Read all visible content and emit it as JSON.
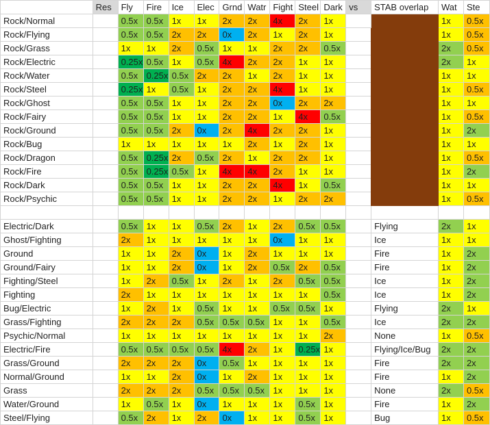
{
  "sheet": {
    "header": {
      "name": "",
      "res": "Res",
      "types": [
        "Fly",
        "Fire",
        "Ice",
        "Elec",
        "Grnd",
        "Watr",
        "Fight",
        "Steel",
        "Dark"
      ],
      "vs": "vs",
      "stab": "STAB overlap",
      "wat": "Wat",
      "ste": "Ste"
    },
    "colors": {
      "0x": "#00B0F0",
      "0.25x": "#00B050",
      "0.5x": "#92D050",
      "1x": "#FFFF00",
      "2x": "#FFC000",
      "4x": "#FF0000",
      "header_gray": "#D9D9D9",
      "stab_block": "#843C0C",
      "offense": {
        "0.5x": "#FFC000",
        "1x": "#FFFF00",
        "2x": "#92D050"
      }
    },
    "upper_rows": [
      {
        "name": "Rock/Normal",
        "vals": [
          "0.5x",
          "0.5x",
          "1x",
          "1x",
          "2x",
          "2x",
          "4x",
          "2x",
          "1x"
        ],
        "wat": "1x",
        "ste": "0.5x"
      },
      {
        "name": "Rock/Flying",
        "vals": [
          "0.5x",
          "0.5x",
          "2x",
          "2x",
          "0x",
          "2x",
          "1x",
          "2x",
          "1x"
        ],
        "wat": "1x",
        "ste": "0.5x"
      },
      {
        "name": "Rock/Grass",
        "vals": [
          "1x",
          "1x",
          "2x",
          "0.5x",
          "1x",
          "1x",
          "2x",
          "2x",
          "0.5x"
        ],
        "wat": "2x",
        "ste": "0.5x"
      },
      {
        "name": "Rock/Electric",
        "vals": [
          "0.25x",
          "0.5x",
          "1x",
          "0.5x",
          "4x",
          "2x",
          "2x",
          "1x",
          "1x"
        ],
        "wat": "2x",
        "ste": "1x"
      },
      {
        "name": "Rock/Water",
        "vals": [
          "0.5x",
          "0.25x",
          "0.5x",
          "2x",
          "2x",
          "1x",
          "2x",
          "1x",
          "1x"
        ],
        "wat": "1x",
        "ste": "1x"
      },
      {
        "name": "Rock/Steel",
        "vals": [
          "0.25x",
          "1x",
          "0.5x",
          "1x",
          "2x",
          "2x",
          "4x",
          "1x",
          "1x"
        ],
        "wat": "1x",
        "ste": "0.5x"
      },
      {
        "name": "Rock/Ghost",
        "vals": [
          "0.5x",
          "0.5x",
          "1x",
          "1x",
          "2x",
          "2x",
          "0x",
          "2x",
          "2x"
        ],
        "wat": "1x",
        "ste": "1x"
      },
      {
        "name": "Rock/Fairy",
        "vals": [
          "0.5x",
          "0.5x",
          "1x",
          "1x",
          "2x",
          "2x",
          "1x",
          "4x",
          "0.5x"
        ],
        "wat": "1x",
        "ste": "0.5x"
      },
      {
        "name": "Rock/Ground",
        "vals": [
          "0.5x",
          "0.5x",
          "2x",
          "0x",
          "2x",
          "4x",
          "2x",
          "2x",
          "1x"
        ],
        "wat": "1x",
        "ste": "2x"
      },
      {
        "name": "Rock/Bug",
        "vals": [
          "1x",
          "1x",
          "1x",
          "1x",
          "1x",
          "2x",
          "1x",
          "2x",
          "1x"
        ],
        "wat": "1x",
        "ste": "1x"
      },
      {
        "name": "Rock/Dragon",
        "vals": [
          "0.5x",
          "0.25x",
          "2x",
          "0.5x",
          "2x",
          "1x",
          "2x",
          "2x",
          "1x"
        ],
        "wat": "1x",
        "ste": "0.5x"
      },
      {
        "name": "Rock/Fire",
        "vals": [
          "0.5x",
          "0.25x",
          "0.5x",
          "1x",
          "4x",
          "4x",
          "2x",
          "1x",
          "1x"
        ],
        "wat": "1x",
        "ste": "2x"
      },
      {
        "name": "Rock/Dark",
        "vals": [
          "0.5x",
          "0.5x",
          "1x",
          "1x",
          "2x",
          "2x",
          "4x",
          "1x",
          "0.5x"
        ],
        "wat": "1x",
        "ste": "1x"
      },
      {
        "name": "Rock/Psychic",
        "vals": [
          "0.5x",
          "0.5x",
          "1x",
          "1x",
          "2x",
          "2x",
          "1x",
          "2x",
          "2x"
        ],
        "wat": "1x",
        "ste": "0.5x"
      }
    ],
    "lower_rows": [
      {
        "name": "Electric/Dark",
        "vals": [
          "0.5x",
          "1x",
          "1x",
          "0.5x",
          "2x",
          "1x",
          "2x",
          "0.5x",
          "0.5x"
        ],
        "stab": "Flying",
        "wat": "2x",
        "ste": "1x"
      },
      {
        "name": "Ghost/Fighting",
        "vals": [
          "2x",
          "1x",
          "1x",
          "1x",
          "1x",
          "1x",
          "0x",
          "1x",
          "1x"
        ],
        "stab": "Ice",
        "wat": "1x",
        "ste": "1x"
      },
      {
        "name": "Ground",
        "vals": [
          "1x",
          "1x",
          "2x",
          "0x",
          "1x",
          "2x",
          "1x",
          "1x",
          "1x"
        ],
        "stab": "Fire",
        "wat": "1x",
        "ste": "2x"
      },
      {
        "name": "Ground/Fairy",
        "vals": [
          "1x",
          "1x",
          "2x",
          "0x",
          "1x",
          "2x",
          "0.5x",
          "2x",
          "0.5x"
        ],
        "stab": "Fire",
        "wat": "1x",
        "ste": "2x"
      },
      {
        "name": "Fighting/Steel",
        "vals": [
          "1x",
          "2x",
          "0.5x",
          "1x",
          "2x",
          "1x",
          "2x",
          "0.5x",
          "0.5x"
        ],
        "stab": "Ice",
        "wat": "1x",
        "ste": "2x"
      },
      {
        "name": "Fighting",
        "vals": [
          "2x",
          "1x",
          "1x",
          "1x",
          "1x",
          "1x",
          "1x",
          "1x",
          "0.5x"
        ],
        "stab": "Ice",
        "wat": "1x",
        "ste": "2x"
      },
      {
        "name": "Bug/Electric",
        "vals": [
          "1x",
          "2x",
          "1x",
          "0.5x",
          "1x",
          "1x",
          "0.5x",
          "0.5x",
          "1x"
        ],
        "stab": "Flying",
        "wat": "2x",
        "ste": "1x"
      },
      {
        "name": "Grass/Fighting",
        "vals": [
          "2x",
          "2x",
          "2x",
          "0.5x",
          "0.5x",
          "0.5x",
          "1x",
          "1x",
          "0.5x"
        ],
        "stab": "Ice",
        "wat": "2x",
        "ste": "2x"
      },
      {
        "name": "Psychic/Normal",
        "vals": [
          "1x",
          "1x",
          "1x",
          "1x",
          "1x",
          "1x",
          "1x",
          "1x",
          "2x"
        ],
        "stab": "None",
        "wat": "1x",
        "ste": "0.5x"
      },
      {
        "name": "Electric/Fire",
        "vals": [
          "0.5x",
          "0.5x",
          "0.5x",
          "0.5x",
          "4x",
          "2x",
          "1x",
          "0.25x",
          "1x"
        ],
        "stab": "Flying/Ice/Bug",
        "wat": "2x",
        "ste": "2x"
      },
      {
        "name": "Grass/Ground",
        "vals": [
          "2x",
          "2x",
          "2x",
          "0x",
          "0.5x",
          "1x",
          "1x",
          "1x",
          "1x"
        ],
        "stab": "Fire",
        "wat": "2x",
        "ste": "2x"
      },
      {
        "name": "Normal/Ground",
        "vals": [
          "1x",
          "1x",
          "2x",
          "0x",
          "1x",
          "2x",
          "1x",
          "1x",
          "1x"
        ],
        "stab": "Fire",
        "wat": "1x",
        "ste": "2x"
      },
      {
        "name": "Grass",
        "vals": [
          "2x",
          "2x",
          "2x",
          "0.5x",
          "0.5x",
          "0.5x",
          "1x",
          "1x",
          "1x"
        ],
        "stab": "None",
        "wat": "2x",
        "ste": "0.5x"
      },
      {
        "name": "Water/Ground",
        "vals": [
          "1x",
          "0.5x",
          "1x",
          "0x",
          "1x",
          "1x",
          "1x",
          "0.5x",
          "1x"
        ],
        "stab": "Fire",
        "wat": "1x",
        "ste": "2x"
      },
      {
        "name": "Steel/Flying",
        "vals": [
          "0.5x",
          "2x",
          "1x",
          "2x",
          "0x",
          "1x",
          "1x",
          "0.5x",
          "1x"
        ],
        "stab": "Bug",
        "wat": "1x",
        "ste": "0.5x"
      }
    ]
  }
}
